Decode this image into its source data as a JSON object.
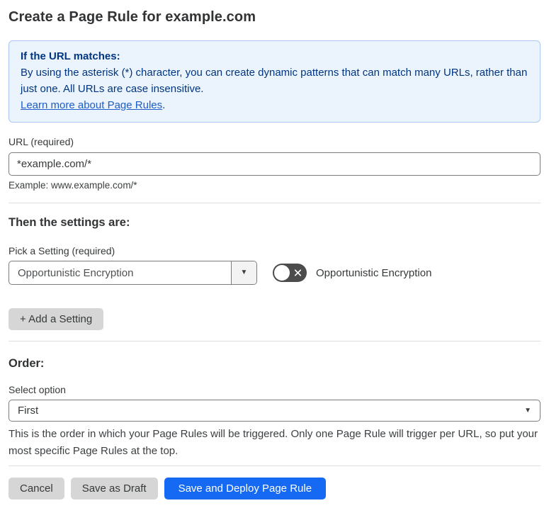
{
  "page": {
    "title": "Create a Page Rule for example.com"
  },
  "info_box": {
    "heading": "If the URL matches:",
    "body": "By using the asterisk (*) character, you can create dynamic patterns that can match many URLs, rather than just one. All URLs are case insensitive.",
    "link_label": "Learn more about Page Rules",
    "link_suffix": "."
  },
  "url_section": {
    "label": "URL (required)",
    "value": "*example.com/*",
    "example": "Example: www.example.com/*"
  },
  "settings_section": {
    "heading": "Then the settings are:",
    "picker_label": "Pick a Setting (required)",
    "picker_value": "Opportunistic Encryption",
    "toggle_label": "Opportunistic Encryption",
    "toggle_state": "off",
    "add_setting_label": "+ Add a Setting"
  },
  "order_section": {
    "heading": "Order:",
    "select_label": "Select option",
    "select_value": "First",
    "help_text": "This is the order in which your Page Rules will be triggered. Only one Page Rule will trigger per URL, so put your most specific Page Rules at the top."
  },
  "footer": {
    "cancel_label": "Cancel",
    "save_draft_label": "Save as Draft",
    "save_deploy_label": "Save and Deploy Page Rule"
  },
  "icons": {
    "dropdown_arrow": "▼",
    "select_arrow": "▼",
    "toggle_off_icon": "x-icon"
  },
  "colors": {
    "accent_blue": "#1569f3",
    "info_bg": "#ebf3fd",
    "info_border": "#abc8f0",
    "info_text": "#003681",
    "link_blue": "#1d5dca",
    "toggle_bg": "#4c4c4c",
    "button_gray": "#d6d6d6",
    "text_dark": "#36393a"
  }
}
